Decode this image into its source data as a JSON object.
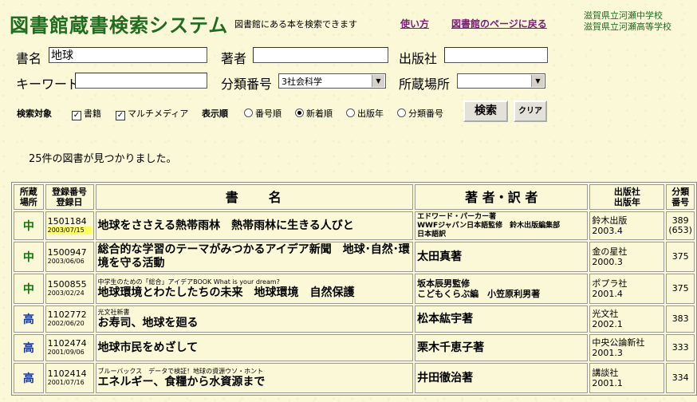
{
  "header": {
    "title": "図書館蔵書検索システム",
    "subtitle": "図書館にある本を検索できます",
    "link_usage": "使い方",
    "link_library": "図書館のページに戻る",
    "school_line1": "滋賀県立河瀬中学校",
    "school_line2": "滋賀県立河瀬高等学校"
  },
  "search": {
    "title_label": "書名",
    "title_value": "地球",
    "author_label": "著者",
    "author_value": "",
    "publisher_label": "出版社",
    "publisher_value": "",
    "keyword_label": "キーワード",
    "keyword_value": "",
    "class_label": "分類番号",
    "class_value": "3社会科学",
    "location_label": "所蔵場所",
    "location_value": "",
    "target_label": "検索対象",
    "target_books": "書籍",
    "target_multimedia": "マルチメディア",
    "sort_label": "表示順",
    "sort_options": [
      "番号順",
      "新着順",
      "出版年",
      "分類番号"
    ],
    "sort_selected": "新着順",
    "search_button": "検索",
    "clear_button": "クリア"
  },
  "result_count": "25件の図書が見つかりました。",
  "table": {
    "headers": {
      "loc1": "所蔵",
      "loc2": "場所",
      "reg1": "登録番号",
      "reg2": "登録日",
      "title": "書　　名",
      "author": "著 者・訳 者",
      "pub1": "出版社",
      "pub2": "出版年",
      "cls1": "分類",
      "cls2": "番号"
    },
    "rows": [
      {
        "loc": "中",
        "regno": "1501184",
        "regdate": "2003/07/15",
        "subtitle": "",
        "title": "地球をささえる熱帯雨林　熱帯雨林に生きる人びと",
        "author_lines": [
          "エドワード・パーカー著",
          "WWFジャパン日本語監修　鈴木出版編集部",
          "日本語訳"
        ],
        "publisher": "鈴木出版",
        "year": "2003.4",
        "class": "389",
        "class2": "(653)"
      },
      {
        "loc": "中",
        "regno": "1500947",
        "regdate": "2003/06/06",
        "subtitle": "",
        "title": "総合的な学習のテーマがみつかるアイデア新聞　地球･自然･環境を守る活動",
        "author_lines": [
          "太田真著"
        ],
        "publisher": "金の星社",
        "year": "2000.3",
        "class": "375",
        "class2": ""
      },
      {
        "loc": "中",
        "regno": "1500855",
        "regdate": "2003/02/24",
        "subtitle": "中学生のための「総合」アイデアBOOK What is your dream?",
        "title": "地球環境とわたしたちの未来　地球環境　自然保護",
        "author_lines": [
          "坂本辰男監修",
          "こどもくらぶ編　小笠原利男著"
        ],
        "publisher": "ポプラ社",
        "year": "2001.4",
        "class": "375",
        "class2": ""
      },
      {
        "loc": "高",
        "regno": "1102772",
        "regdate": "2002/06/20",
        "subtitle": "光文社新書",
        "title": "お寿司、地球を廻る",
        "author_lines": [
          "松本紘宇著"
        ],
        "publisher": "光文社",
        "year": "2002.1",
        "class": "383",
        "class2": ""
      },
      {
        "loc": "高",
        "regno": "1102474",
        "regdate": "2001/09/06",
        "subtitle": "",
        "title": "地球市民をめざして",
        "author_lines": [
          "栗木千恵子著"
        ],
        "publisher": "中央公論新社",
        "year": "2001.3",
        "class": "333",
        "class2": ""
      },
      {
        "loc": "高",
        "regno": "1102414",
        "regdate": "2001/07/16",
        "subtitle": "ブルーバックス　データで検証！地球の資源ウソ・ホント",
        "title": "エネルギー、食糧から水資源まで",
        "author_lines": [
          "井田徹治著"
        ],
        "publisher": "講談社",
        "year": "2001.1",
        "class": "334",
        "class2": ""
      }
    ]
  }
}
